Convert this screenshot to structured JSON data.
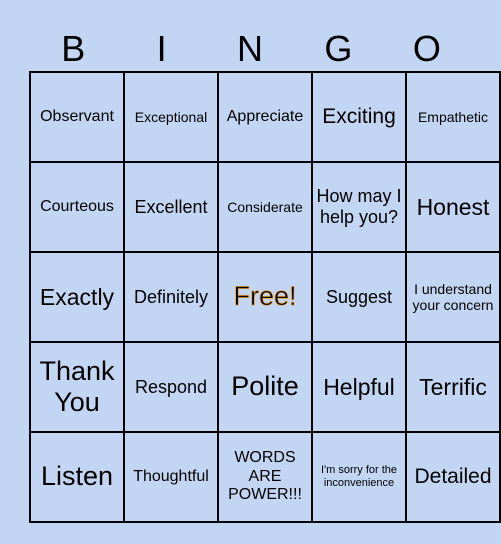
{
  "header": [
    "B",
    "I",
    "N",
    "G",
    "O"
  ],
  "rows": [
    [
      "Observant",
      "Exceptional",
      "Appreciate",
      "Exciting",
      "Empathetic"
    ],
    [
      "Courteous",
      "Excellent",
      "Considerate",
      "How may I help you?",
      "Honest"
    ],
    [
      "Exactly",
      "Definitely",
      "Free!",
      "Suggest",
      "I understand your concern"
    ],
    [
      "Thank You",
      "Respond",
      "Polite",
      "Helpful",
      "Terrific"
    ],
    [
      "Listen",
      "Thoughtful",
      "WORDS ARE POWER!!!",
      "I'm sorry for the inconvenience",
      "Detailed"
    ]
  ],
  "colors": {
    "background": "#c2d5f2",
    "free_outline": "#f39b1a"
  }
}
